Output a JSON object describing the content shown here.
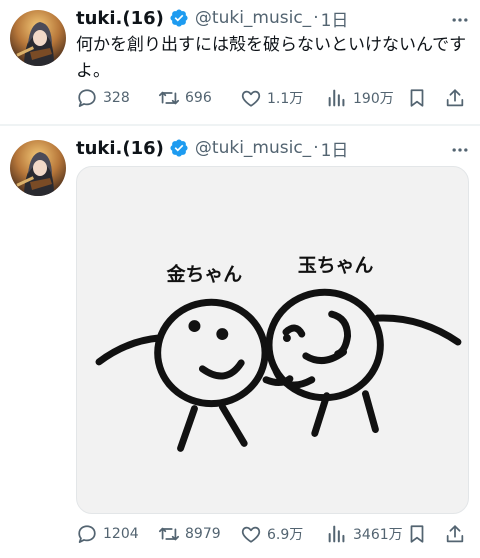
{
  "tweets": [
    {
      "author_name": "tuki.(16)",
      "handle": "@tuki_music_",
      "separator": "·",
      "time": "1日",
      "text": "何かを創り出すには殻を破らないといけないんですよ。",
      "metrics": {
        "replies": "328",
        "reposts": "696",
        "likes": "1.1万",
        "views": "190万"
      }
    },
    {
      "author_name": "tuki.(16)",
      "handle": "@tuki_music_",
      "separator": "·",
      "time": "1日",
      "media": {
        "label_left": "金ちゃん",
        "label_right": "玉ちゃん"
      },
      "metrics": {
        "replies": "1204",
        "reposts": "8979",
        "likes": "6.9万",
        "views": "3461万"
      }
    }
  ],
  "icons": {
    "verified": "verified-badge-icon",
    "more": "more-icon",
    "reply": "reply-icon",
    "repost": "repost-icon",
    "like": "like-icon",
    "views": "views-icon",
    "bookmark": "bookmark-icon",
    "share": "share-icon"
  },
  "colors": {
    "verified": "#1d9bf0",
    "secondary_text": "#536471",
    "primary_text": "#0f1419"
  }
}
